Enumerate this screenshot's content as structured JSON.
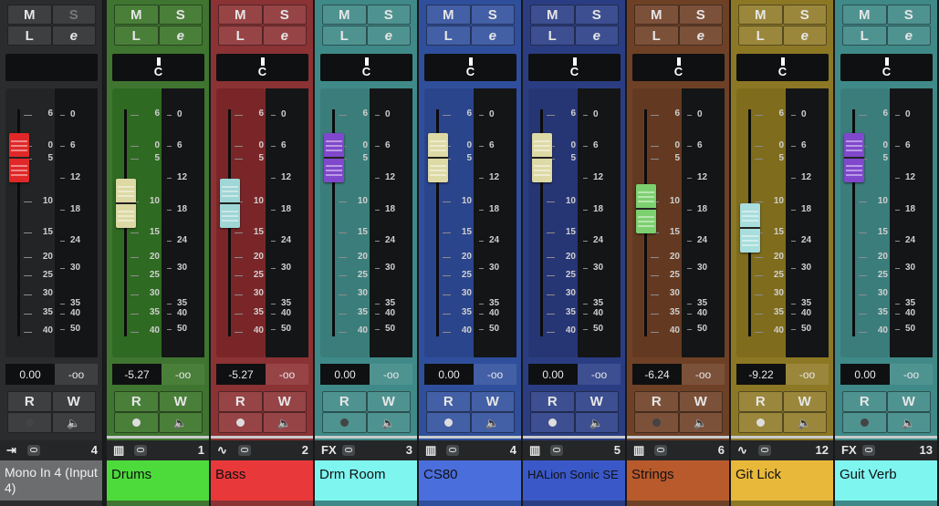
{
  "scale_left": [
    "6",
    "6",
    "0",
    "5",
    "10",
    "15",
    "20",
    "25",
    "30",
    "35",
    "40",
    "00"
  ],
  "scale_right": [
    "0",
    "6",
    "12",
    "18",
    "24",
    "30",
    "35",
    "40",
    "50"
  ],
  "buttons": {
    "mute": "M",
    "solo": "S",
    "listen": "L",
    "edit": "e",
    "read": "R",
    "write": "W"
  },
  "channels": [
    {
      "name": "Mono In 4 (Input 4)",
      "number": "4",
      "type_icon": "input",
      "pan": "",
      "fader_value": "0.00",
      "meter_value": "-oo",
      "fader_level_db": 0,
      "knob_color": "#e02828",
      "bg": "#2b2c2e",
      "panel": "#232425",
      "btn": "#3d3f41",
      "name_bg": "#6c6d6e",
      "name_color": "#f0f0f0",
      "solo_dim": true,
      "rw_dim": true
    },
    {
      "name": "Drums",
      "number": "1",
      "type_icon": "instrument",
      "pan": "C",
      "fader_value": "-5.27",
      "meter_value": "-oo",
      "fader_level_db": -5.27,
      "knob_color": "#ddd9a4",
      "bg": "#3f7530",
      "panel": "#2f6a22",
      "btn": "#4a7f3a",
      "name_bg": "#4ddb3c",
      "name_color": "#111111",
      "solo_dim": false,
      "rw_dim": false
    },
    {
      "name": "Bass",
      "number": "2",
      "type_icon": "audio",
      "pan": "C",
      "fader_value": "-5.27",
      "meter_value": "-oo",
      "fader_level_db": -5.27,
      "knob_color": "#9fd6d6",
      "bg": "#8a3234",
      "panel": "#7a2628",
      "btn": "#974446",
      "name_bg": "#e8383a",
      "name_color": "#111111",
      "solo_dim": false,
      "rw_dim": false
    },
    {
      "name": "Drm Room",
      "number": "3",
      "type_icon": "fx",
      "pan": "C",
      "fader_value": "0.00",
      "meter_value": "-oo",
      "fader_level_db": 0,
      "knob_color": "#8048cc",
      "bg": "#3f8a88",
      "panel": "#3a7d7b",
      "btn": "#4f9391",
      "name_bg": "#7ff5f0",
      "name_color": "#111111",
      "solo_dim": false,
      "rw_dim": true
    },
    {
      "name": "CS80",
      "number": "4",
      "type_icon": "instrument",
      "pan": "C",
      "fader_value": "0.00",
      "meter_value": "-oo",
      "fader_level_db": 0,
      "knob_color": "#dedaa6",
      "bg": "#2f4f9c",
      "panel": "#2a458c",
      "btn": "#435fa5",
      "name_bg": "#4a6edc",
      "name_color": "#111111",
      "solo_dim": false,
      "rw_dim": false
    },
    {
      "name": "HALion Sonic SE",
      "number": "5",
      "type_icon": "instrument",
      "pan": "C",
      "fader_value": "0.00",
      "meter_value": "-oo",
      "fader_level_db": 0,
      "knob_color": "#dedaa6",
      "bg": "#2b3d82",
      "panel": "#263574",
      "btn": "#3d4f91",
      "name_bg": "#3a58c8",
      "name_color": "#111111",
      "solo_dim": false,
      "rw_dim": false
    },
    {
      "name": "Strings",
      "number": "6",
      "type_icon": "instrument",
      "pan": "C",
      "fader_value": "-6.24",
      "meter_value": "-oo",
      "fader_level_db": -6.24,
      "knob_color": "#7cd070",
      "bg": "#6e4126",
      "panel": "#633a21",
      "btn": "#7c513a",
      "name_bg": "#b85a2c",
      "name_color": "#111111",
      "solo_dim": false,
      "rw_dim": true
    },
    {
      "name": "Git Lick",
      "number": "12",
      "type_icon": "audio",
      "pan": "C",
      "fader_value": "-9.22",
      "meter_value": "-oo",
      "fader_level_db": -9.22,
      "knob_color": "#a8dedd",
      "bg": "#8c7824",
      "panel": "#7f6c1c",
      "btn": "#9a873b",
      "name_bg": "#e8b83a",
      "name_color": "#111111",
      "solo_dim": false,
      "rw_dim": false
    },
    {
      "name": "Guit Verb",
      "number": "13",
      "type_icon": "fx",
      "pan": "C",
      "fader_value": "0.00",
      "meter_value": "-oo",
      "fader_level_db": 0,
      "knob_color": "#8048cc",
      "bg": "#3f8a88",
      "panel": "#3a7d7b",
      "btn": "#4f9391",
      "name_bg": "#7ff5f0",
      "name_color": "#111111",
      "solo_dim": false,
      "rw_dim": true
    }
  ]
}
